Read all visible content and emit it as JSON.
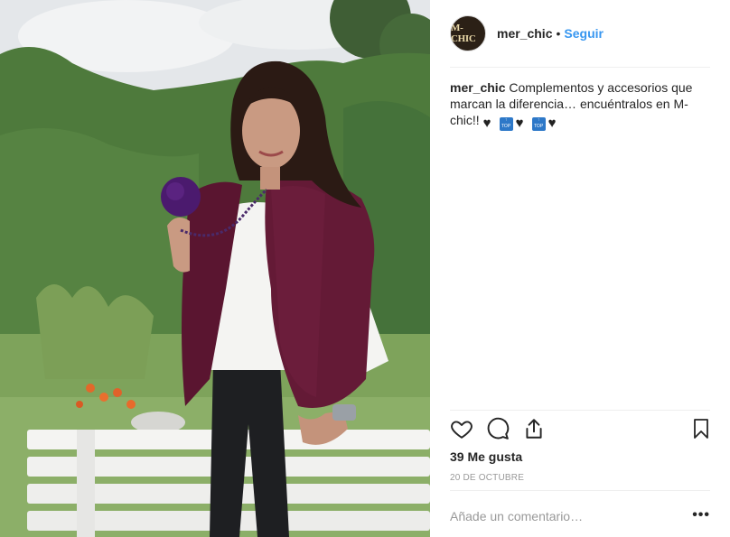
{
  "post": {
    "username": "mer_chic",
    "separator": "•",
    "follow_label": "Seguir",
    "avatar_text": "M-CHIC",
    "caption_user": "mer_chic",
    "caption_text": "Complementos y accesorios que marcan la diferencia… encuéntralos en M-chic!!",
    "caption_emojis": [
      "black-heart-icon",
      "top-arrow-icon",
      "black-heart-icon",
      "top-arrow-icon",
      "black-heart-icon"
    ],
    "likes": "39 Me gusta",
    "date": "20 DE OCTUBRE",
    "comment_placeholder": "Añade un comentario…",
    "more_label": "•••"
  },
  "colors": {
    "link": "#3897f0",
    "text": "#262626",
    "muted": "#999999",
    "divider": "#efefef"
  }
}
